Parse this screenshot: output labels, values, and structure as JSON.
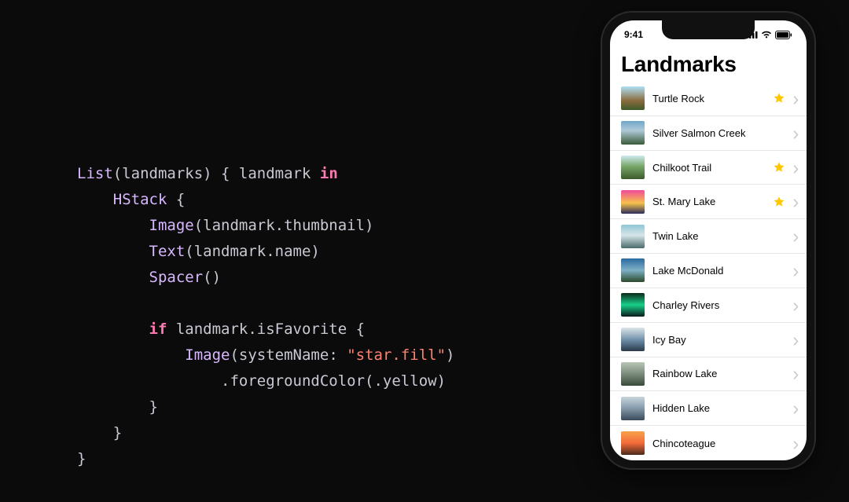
{
  "code": {
    "l1": {
      "a": "List",
      "b": "(landmarks) { landmark ",
      "c": "in"
    },
    "l2": {
      "a": "HStack",
      "b": " {"
    },
    "l3": {
      "a": "Image",
      "b": "(landmark.thumbnail)"
    },
    "l4": {
      "a": "Text",
      "b": "(landmark.name)"
    },
    "l5": {
      "a": "Spacer",
      "b": "()"
    },
    "l7": {
      "a": "if",
      "b": " landmark.isFavorite {"
    },
    "l8": {
      "a": "Image",
      "b": "(systemName: ",
      "c": "\"star.fill\"",
      "d": ")"
    },
    "l9": {
      "a": ".foregroundColor(.yellow)"
    },
    "l10": "}",
    "l11": "}",
    "l12": "}"
  },
  "phone": {
    "time": "9:41",
    "title": "Landmarks",
    "items": [
      {
        "name": "Turtle Rock",
        "favorite": true
      },
      {
        "name": "Silver Salmon Creek",
        "favorite": false
      },
      {
        "name": "Chilkoot Trail",
        "favorite": true
      },
      {
        "name": "St. Mary Lake",
        "favorite": true
      },
      {
        "name": "Twin Lake",
        "favorite": false
      },
      {
        "name": "Lake McDonald",
        "favorite": false
      },
      {
        "name": "Charley Rivers",
        "favorite": false
      },
      {
        "name": "Icy Bay",
        "favorite": false
      },
      {
        "name": "Rainbow Lake",
        "favorite": false
      },
      {
        "name": "Hidden Lake",
        "favorite": false
      },
      {
        "name": "Chincoteague",
        "favorite": false
      }
    ]
  }
}
